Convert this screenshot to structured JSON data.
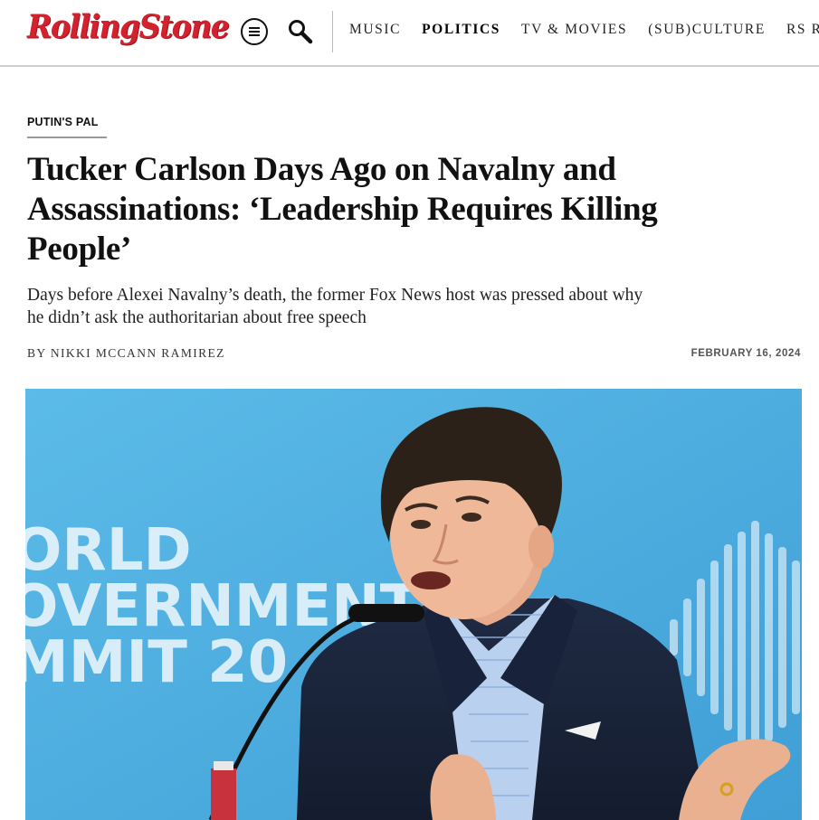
{
  "site": {
    "logo_text": "RollingStone",
    "brand_color": "#d3212d"
  },
  "nav": {
    "menu_icon": "hamburger-menu-icon",
    "search_icon": "search-icon",
    "items": [
      {
        "label": "Music",
        "active": false
      },
      {
        "label": "Politics",
        "active": true
      },
      {
        "label": "TV & Movies",
        "active": false
      },
      {
        "label": "(Sub)Culture",
        "active": false
      },
      {
        "label": "RS R",
        "active": false
      }
    ]
  },
  "article": {
    "kicker": "PUTIN'S PAL",
    "headline": "Tucker Carlson Days Ago on Navalny and Assassinations: ‘Leadership Requires Killing People’",
    "dek": "Days before Alexei Navalny’s death, the former Fox News host was pressed about why he didn’t ask the authoritarian about free speech",
    "byline": "By Nikki McCann Ramirez",
    "date": "February 16, 2024"
  },
  "hero_image": {
    "backdrop_text_lines": [
      "ORLD",
      "OVERNMENT",
      "MMIT 20"
    ],
    "backdrop_color": "#4fb2e3"
  }
}
